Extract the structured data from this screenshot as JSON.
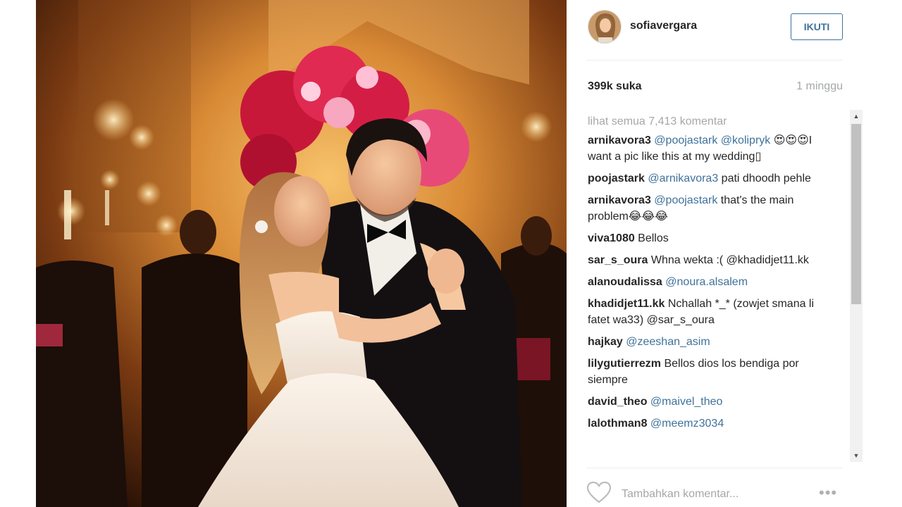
{
  "post": {
    "username": "sofiavergara",
    "follow_label": "IKUTI",
    "likes": "399k suka",
    "time_ago": "1 minggu",
    "view_all": "lihat semua 7,413 komentar",
    "comment_placeholder": "Tambahkan komentar...",
    "more_label": "•••"
  },
  "comments": [
    {
      "user": "arnikavora3",
      "mention": "@poojastark @kolipryk",
      "text": " 😍😍😍I want a pic like this at my wedding▯"
    },
    {
      "user": "poojastark",
      "mention": "@arnikavora3",
      "text": " pati dhoodh pehle"
    },
    {
      "user": "arnikavora3",
      "mention": "@poojastark",
      "text": " that's the main problem😂😂😂"
    },
    {
      "user": "viva1080",
      "mention": "",
      "text": " Bellos"
    },
    {
      "user": "sar_s_oura",
      "mention": "",
      "text": " Whna wekta :( @khadidjet11.kk"
    },
    {
      "user": "alanoudalissa",
      "mention": "@noura.alsalem",
      "text": ""
    },
    {
      "user": "khadidjet11.kk",
      "mention": "",
      "text": " Nchallah *_* (zowjet smana li fatet wa33) @sar_s_oura"
    },
    {
      "user": "hajkay",
      "mention": "@zeeshan_asim",
      "text": ""
    },
    {
      "user": "lilygutierrezm",
      "mention": "",
      "text": " Bellos dios los bendiga por siempre"
    },
    {
      "user": "david_theo",
      "mention": "@maivel_theo",
      "text": ""
    },
    {
      "user": "lalothman8",
      "mention": "@meemz3034",
      "text": ""
    }
  ],
  "icons": {
    "heart": "heart-outline-icon",
    "scroll_up": "▲",
    "scroll_down": "▼"
  },
  "colors": {
    "link_blue": "#3f729b",
    "muted_gray": "#a5a7aa",
    "text_dark": "#262626"
  }
}
